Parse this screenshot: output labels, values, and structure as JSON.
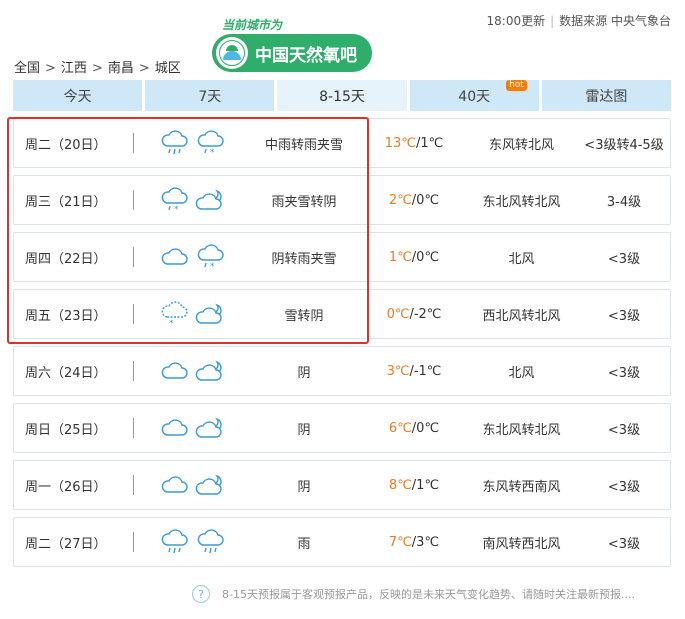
{
  "header": {
    "slogan": "当前城市为",
    "logo_text": "中国天然氧吧",
    "update_time": "18:00更新",
    "source": "数据来源 中央气象台"
  },
  "breadcrumb": [
    "全国",
    "江西",
    "南昌",
    "城区"
  ],
  "tabs": [
    {
      "label": "今天"
    },
    {
      "label": "7天"
    },
    {
      "label": "8-15天",
      "active": true
    },
    {
      "label": "40天",
      "badge": "hot"
    },
    {
      "label": "雷达图"
    }
  ],
  "forecast": [
    {
      "date": "周二（20日）",
      "icon_day": "cloud-rain-icon",
      "icon_night": "cloud-sleet-icon",
      "desc": "中雨转雨夹雪",
      "high": "13℃",
      "low": "/1℃",
      "wind": "东风转北风",
      "level": "<3级转4-5级"
    },
    {
      "date": "周三（21日）",
      "icon_day": "cloud-sleet-icon",
      "icon_night": "moon-cloud-icon",
      "desc": "雨夹雪转阴",
      "high": "2℃",
      "low": "/0℃",
      "wind": "东北风转北风",
      "level": "3-4级"
    },
    {
      "date": "周四（22日）",
      "icon_day": "cloud-icon",
      "icon_night": "cloud-sleet-icon",
      "desc": "阴转雨夹雪",
      "high": "1℃",
      "low": "/0℃",
      "wind": "北风",
      "level": "<3级"
    },
    {
      "date": "周五（23日）",
      "icon_day": "cloud-snow-icon",
      "icon_night": "moon-cloud-icon",
      "desc": "雪转阴",
      "high": "0℃",
      "low": "/-2℃",
      "wind": "西北风转北风",
      "level": "<3级"
    },
    {
      "date": "周六（24日）",
      "icon_day": "cloud-icon",
      "icon_night": "moon-cloud-icon",
      "desc": "阴",
      "high": "3℃",
      "low": "/-1℃",
      "wind": "北风",
      "level": "<3级"
    },
    {
      "date": "周日（25日）",
      "icon_day": "cloud-icon",
      "icon_night": "moon-cloud-icon",
      "desc": "阴",
      "high": "6℃",
      "low": "/0℃",
      "wind": "东北风转北风",
      "level": "<3级"
    },
    {
      "date": "周一（26日）",
      "icon_day": "cloud-icon",
      "icon_night": "moon-cloud-icon",
      "desc": "阴",
      "high": "8℃",
      "low": "/1℃",
      "wind": "东风转西南风",
      "level": "<3级"
    },
    {
      "date": "周二（27日）",
      "icon_day": "cloud-rain-icon",
      "icon_night": "cloud-rain-icon",
      "desc": "雨",
      "high": "7℃",
      "low": "/3℃",
      "wind": "南风转西北风",
      "level": "<3级"
    }
  ],
  "footnote": "8-15天预报属于客观预报产品，反映的是未来天气变化趋势、请随时关注最新预报....",
  "colors": {
    "accent_green": "#2fae6b",
    "temp_high": "#f07a1e",
    "highlight": "#e0302a",
    "tab_bg": "#cfe8f8"
  }
}
